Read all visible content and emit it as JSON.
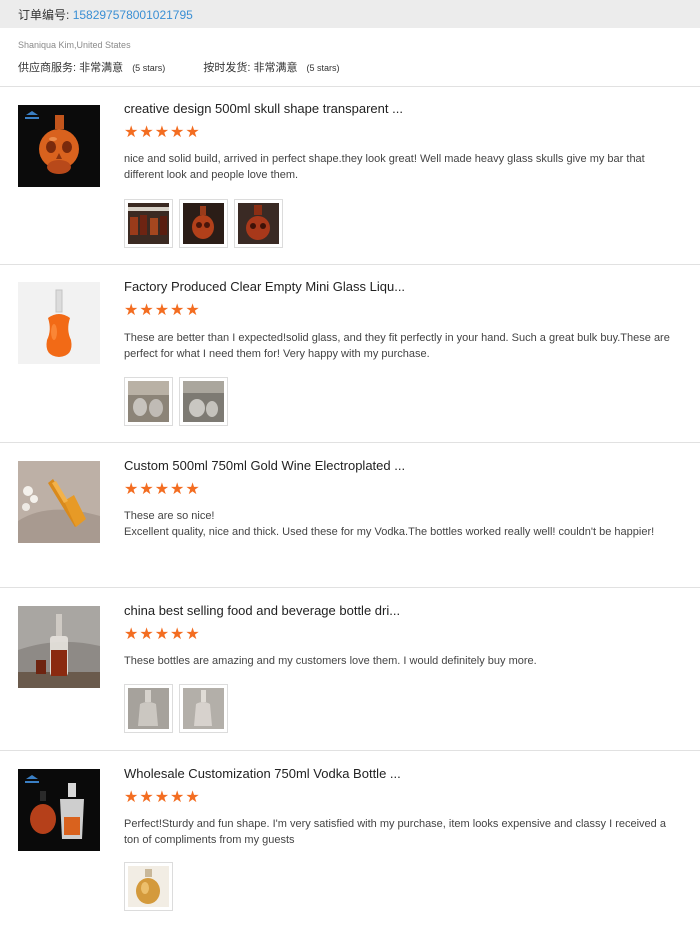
{
  "order": {
    "label": "订单编号:",
    "number": "158297578001021795"
  },
  "buyer": "Shaniqua Kim,United States",
  "seller_rating": {
    "label": "供应商服务:",
    "value": "非常满意",
    "stars_text": "(5 stars)"
  },
  "delivery_rating": {
    "label": "按时发货:",
    "value": "非常满意",
    "stars_text": "(5 stars)"
  },
  "accent_color": "#f36d21",
  "link_color": "#3a8fd4",
  "reviews": [
    {
      "title": "creative design 500ml skull shape transparent ...",
      "rating": 5,
      "lines": [
        "nice and solid build, arrived in perfect shape.they look great! Well made heavy glass skulls give my bar that different look and people love them."
      ],
      "photo_count": 3
    },
    {
      "title": "Factory Produced Clear Empty Mini Glass Liqu...",
      "rating": 5,
      "lines": [
        "These are better than I expected!solid glass, and they fit perfectly in your hand. Such a great bulk buy.These are perfect for what I need them for! Very happy with my purchase."
      ],
      "photo_count": 2
    },
    {
      "title": "Custom 500ml 750ml Gold Wine Electroplated ...",
      "rating": 5,
      "lines": [
        "These are so nice!",
        "Excellent quality, nice and thick. Used these for my Vodka.The bottles worked really well! couldn't be happier!"
      ],
      "photo_count": 0
    },
    {
      "title": "china best selling food and beverage bottle dri...",
      "rating": 5,
      "lines": [
        "These bottles are amazing and my customers love them. I would definitely buy more."
      ],
      "photo_count": 2
    },
    {
      "title": "Wholesale Customization 750ml Vodka Bottle ...",
      "rating": 5,
      "lines": [
        "Perfect!Sturdy and fun shape. I'm very satisfied with my purchase, item looks expensive and classy I received a ton of compliments from my guests"
      ],
      "photo_count": 1
    }
  ]
}
